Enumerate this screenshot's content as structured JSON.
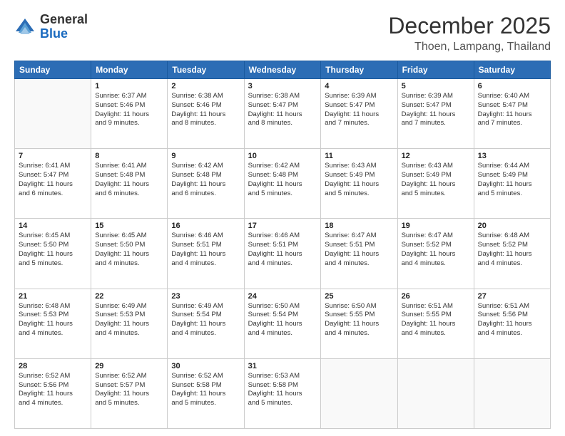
{
  "logo": {
    "general": "General",
    "blue": "Blue"
  },
  "header": {
    "month": "December 2025",
    "location": "Thoen, Lampang, Thailand"
  },
  "weekdays": [
    "Sunday",
    "Monday",
    "Tuesday",
    "Wednesday",
    "Thursday",
    "Friday",
    "Saturday"
  ],
  "weeks": [
    [
      {
        "day": "",
        "info": ""
      },
      {
        "day": "1",
        "info": "Sunrise: 6:37 AM\nSunset: 5:46 PM\nDaylight: 11 hours\nand 9 minutes."
      },
      {
        "day": "2",
        "info": "Sunrise: 6:38 AM\nSunset: 5:46 PM\nDaylight: 11 hours\nand 8 minutes."
      },
      {
        "day": "3",
        "info": "Sunrise: 6:38 AM\nSunset: 5:47 PM\nDaylight: 11 hours\nand 8 minutes."
      },
      {
        "day": "4",
        "info": "Sunrise: 6:39 AM\nSunset: 5:47 PM\nDaylight: 11 hours\nand 7 minutes."
      },
      {
        "day": "5",
        "info": "Sunrise: 6:39 AM\nSunset: 5:47 PM\nDaylight: 11 hours\nand 7 minutes."
      },
      {
        "day": "6",
        "info": "Sunrise: 6:40 AM\nSunset: 5:47 PM\nDaylight: 11 hours\nand 7 minutes."
      }
    ],
    [
      {
        "day": "7",
        "info": "Sunrise: 6:41 AM\nSunset: 5:47 PM\nDaylight: 11 hours\nand 6 minutes."
      },
      {
        "day": "8",
        "info": "Sunrise: 6:41 AM\nSunset: 5:48 PM\nDaylight: 11 hours\nand 6 minutes."
      },
      {
        "day": "9",
        "info": "Sunrise: 6:42 AM\nSunset: 5:48 PM\nDaylight: 11 hours\nand 6 minutes."
      },
      {
        "day": "10",
        "info": "Sunrise: 6:42 AM\nSunset: 5:48 PM\nDaylight: 11 hours\nand 5 minutes."
      },
      {
        "day": "11",
        "info": "Sunrise: 6:43 AM\nSunset: 5:49 PM\nDaylight: 11 hours\nand 5 minutes."
      },
      {
        "day": "12",
        "info": "Sunrise: 6:43 AM\nSunset: 5:49 PM\nDaylight: 11 hours\nand 5 minutes."
      },
      {
        "day": "13",
        "info": "Sunrise: 6:44 AM\nSunset: 5:49 PM\nDaylight: 11 hours\nand 5 minutes."
      }
    ],
    [
      {
        "day": "14",
        "info": "Sunrise: 6:45 AM\nSunset: 5:50 PM\nDaylight: 11 hours\nand 5 minutes."
      },
      {
        "day": "15",
        "info": "Sunrise: 6:45 AM\nSunset: 5:50 PM\nDaylight: 11 hours\nand 4 minutes."
      },
      {
        "day": "16",
        "info": "Sunrise: 6:46 AM\nSunset: 5:51 PM\nDaylight: 11 hours\nand 4 minutes."
      },
      {
        "day": "17",
        "info": "Sunrise: 6:46 AM\nSunset: 5:51 PM\nDaylight: 11 hours\nand 4 minutes."
      },
      {
        "day": "18",
        "info": "Sunrise: 6:47 AM\nSunset: 5:51 PM\nDaylight: 11 hours\nand 4 minutes."
      },
      {
        "day": "19",
        "info": "Sunrise: 6:47 AM\nSunset: 5:52 PM\nDaylight: 11 hours\nand 4 minutes."
      },
      {
        "day": "20",
        "info": "Sunrise: 6:48 AM\nSunset: 5:52 PM\nDaylight: 11 hours\nand 4 minutes."
      }
    ],
    [
      {
        "day": "21",
        "info": "Sunrise: 6:48 AM\nSunset: 5:53 PM\nDaylight: 11 hours\nand 4 minutes."
      },
      {
        "day": "22",
        "info": "Sunrise: 6:49 AM\nSunset: 5:53 PM\nDaylight: 11 hours\nand 4 minutes."
      },
      {
        "day": "23",
        "info": "Sunrise: 6:49 AM\nSunset: 5:54 PM\nDaylight: 11 hours\nand 4 minutes."
      },
      {
        "day": "24",
        "info": "Sunrise: 6:50 AM\nSunset: 5:54 PM\nDaylight: 11 hours\nand 4 minutes."
      },
      {
        "day": "25",
        "info": "Sunrise: 6:50 AM\nSunset: 5:55 PM\nDaylight: 11 hours\nand 4 minutes."
      },
      {
        "day": "26",
        "info": "Sunrise: 6:51 AM\nSunset: 5:55 PM\nDaylight: 11 hours\nand 4 minutes."
      },
      {
        "day": "27",
        "info": "Sunrise: 6:51 AM\nSunset: 5:56 PM\nDaylight: 11 hours\nand 4 minutes."
      }
    ],
    [
      {
        "day": "28",
        "info": "Sunrise: 6:52 AM\nSunset: 5:56 PM\nDaylight: 11 hours\nand 4 minutes."
      },
      {
        "day": "29",
        "info": "Sunrise: 6:52 AM\nSunset: 5:57 PM\nDaylight: 11 hours\nand 5 minutes."
      },
      {
        "day": "30",
        "info": "Sunrise: 6:52 AM\nSunset: 5:58 PM\nDaylight: 11 hours\nand 5 minutes."
      },
      {
        "day": "31",
        "info": "Sunrise: 6:53 AM\nSunset: 5:58 PM\nDaylight: 11 hours\nand 5 minutes."
      },
      {
        "day": "",
        "info": ""
      },
      {
        "day": "",
        "info": ""
      },
      {
        "day": "",
        "info": ""
      }
    ]
  ]
}
